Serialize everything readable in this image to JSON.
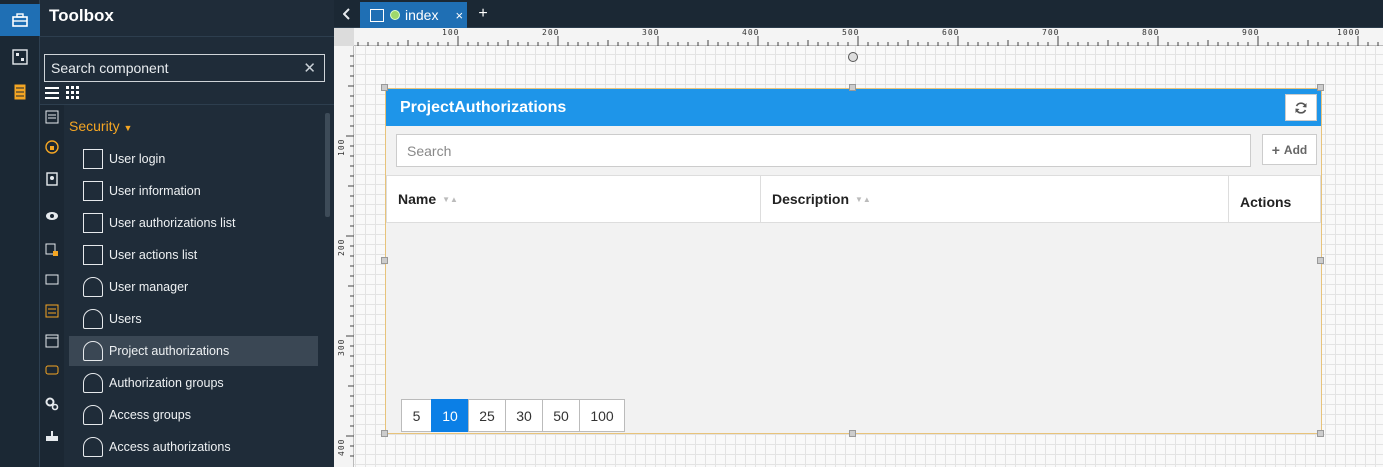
{
  "toolbox": {
    "title": "Toolbox",
    "search_placeholder": "Search component",
    "clear_symbol": "✕",
    "category": "Security",
    "items": [
      {
        "label": "User login",
        "icon": "user-login-icon"
      },
      {
        "label": "User information",
        "icon": "user-information-icon"
      },
      {
        "label": "User authorizations list",
        "icon": "list-icon"
      },
      {
        "label": "User actions list",
        "icon": "list-icon"
      },
      {
        "label": "User manager",
        "icon": "users-icon"
      },
      {
        "label": "Users",
        "icon": "users-icon"
      },
      {
        "label": "Project authorizations",
        "icon": "users-icon",
        "selected": true
      },
      {
        "label": "Authorization groups",
        "icon": "users-icon"
      },
      {
        "label": "Access groups",
        "icon": "users-icon"
      },
      {
        "label": "Access authorizations",
        "icon": "users-icon"
      }
    ],
    "category_color": "#f5a623"
  },
  "tabs": {
    "back": "<",
    "active_tab": "index",
    "close": "×",
    "add": "+"
  },
  "ruler": {
    "top": [
      "100",
      "200",
      "300",
      "400",
      "500",
      "600",
      "700",
      "800",
      "900",
      "1000"
    ],
    "left": [
      "100",
      "200",
      "300",
      "400"
    ]
  },
  "widget": {
    "title": "ProjectAuthorizations",
    "refresh_icon": "refresh-icon",
    "search_placeholder": "Search",
    "add_label": "Add",
    "columns": [
      "Name",
      "Description",
      "Actions"
    ],
    "page_sizes": [
      "5",
      "10",
      "25",
      "30",
      "50",
      "100"
    ],
    "active_page_size": "10",
    "header_color": "#1e95e9",
    "accent_color": "#0b7fe6"
  }
}
